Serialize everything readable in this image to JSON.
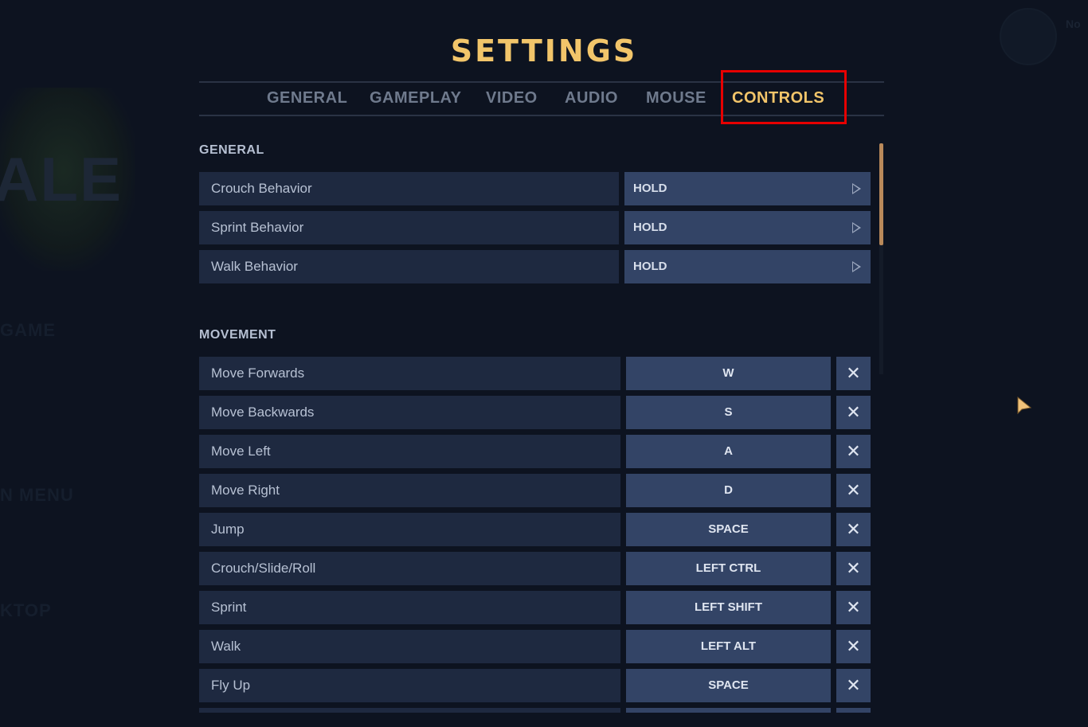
{
  "background": {
    "logo_text": "ALE",
    "menu_items": [
      "GAME",
      "N MENU",
      "KTOP"
    ],
    "profile_name": "No"
  },
  "header": {
    "title": "SETTINGS",
    "tabs": [
      {
        "label": "GENERAL",
        "active": false
      },
      {
        "label": "GAMEPLAY",
        "active": false
      },
      {
        "label": "VIDEO",
        "active": false
      },
      {
        "label": "AUDIO",
        "active": false
      },
      {
        "label": "MOUSE",
        "active": false
      },
      {
        "label": "CONTROLS",
        "active": true
      }
    ]
  },
  "sections": {
    "general": {
      "title": "GENERAL",
      "rows": [
        {
          "label": "Crouch Behavior",
          "value": "HOLD"
        },
        {
          "label": "Sprint Behavior",
          "value": "HOLD"
        },
        {
          "label": "Walk Behavior",
          "value": "HOLD"
        }
      ]
    },
    "movement": {
      "title": "MOVEMENT",
      "rows": [
        {
          "label": "Move Forwards",
          "key": "W"
        },
        {
          "label": "Move Backwards",
          "key": "S"
        },
        {
          "label": "Move Left",
          "key": "A"
        },
        {
          "label": "Move Right",
          "key": "D"
        },
        {
          "label": "Jump",
          "key": "SPACE"
        },
        {
          "label": "Crouch/Slide/Roll",
          "key": "LEFT CTRL"
        },
        {
          "label": "Sprint",
          "key": "LEFT SHIFT"
        },
        {
          "label": "Walk",
          "key": "LEFT ALT"
        },
        {
          "label": "Fly Up",
          "key": "SPACE"
        }
      ]
    }
  },
  "icons": {
    "clear": "✕",
    "select_arrow": "play-triangle-icon"
  },
  "colors": {
    "accent": "#f2c56a",
    "row_bg": "#1e2940",
    "control_bg": "#334466",
    "highlight": "#e60000",
    "scroll_thumb": "#b9895a"
  }
}
